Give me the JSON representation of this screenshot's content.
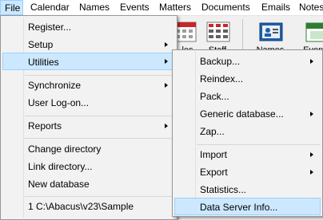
{
  "menubar": {
    "items": [
      "File",
      "Calendar",
      "Names",
      "Events",
      "Matters",
      "Documents",
      "Emails",
      "Notes"
    ]
  },
  "toolbar": {
    "buttons": [
      {
        "label": "...les",
        "icon": "calendar-grid-icon"
      },
      {
        "label": "Staff",
        "icon": "staff-grid-icon"
      },
      {
        "label": "Names",
        "icon": "names-card-icon"
      },
      {
        "label": "Events",
        "icon": "events-calendar-icon"
      }
    ]
  },
  "file_menu": {
    "items": [
      {
        "label": "Register...",
        "submenu": false
      },
      {
        "label": "Setup",
        "submenu": true
      },
      {
        "label": "Utilities",
        "submenu": true,
        "highlighted": true
      },
      {
        "label": "Synchronize",
        "submenu": true
      },
      {
        "label": "User Log-on...",
        "submenu": false
      },
      {
        "label": "Reports",
        "submenu": true
      },
      {
        "label": "Change directory",
        "submenu": false
      },
      {
        "label": "Link directory...",
        "submenu": false
      },
      {
        "label": "New database",
        "submenu": false
      },
      {
        "label": "1 C:\\Abacus\\v23\\Sample",
        "submenu": false
      }
    ]
  },
  "utilities_menu": {
    "items": [
      {
        "label": "Backup...",
        "submenu": true
      },
      {
        "label": "Reindex...",
        "submenu": false
      },
      {
        "label": "Pack...",
        "submenu": false
      },
      {
        "label": "Generic database...",
        "submenu": true
      },
      {
        "label": "Zap...",
        "submenu": false
      },
      {
        "label": "Import",
        "submenu": true
      },
      {
        "label": "Export",
        "submenu": true
      },
      {
        "label": "Statistics...",
        "submenu": false
      },
      {
        "label": "Data Server Info...",
        "submenu": false,
        "highlighted": true
      }
    ]
  },
  "colors": {
    "highlight_bg": "#cce8ff",
    "highlight_border": "#99d1ff",
    "menu_bg": "#f2f2f2"
  }
}
